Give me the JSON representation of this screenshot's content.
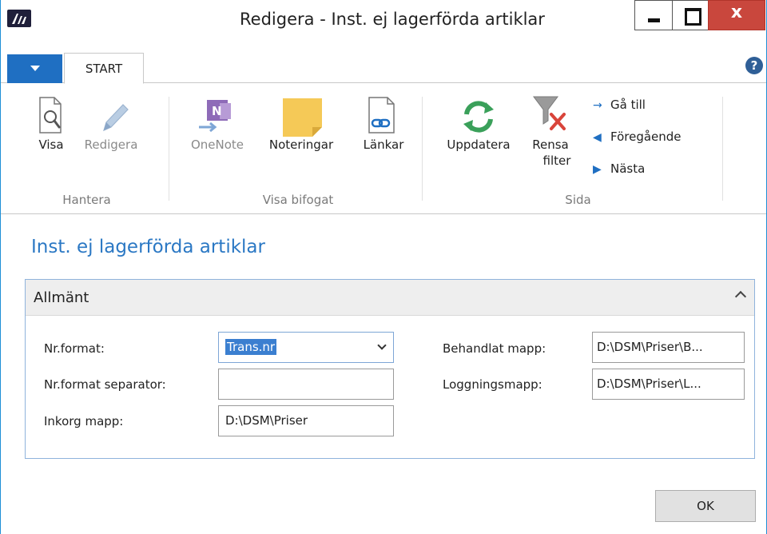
{
  "window": {
    "title": "Redigera - Inst. ej lagerförda artiklar",
    "close_label": "x"
  },
  "tabs": {
    "start": "START",
    "help": "?"
  },
  "ribbon": {
    "groups": {
      "hantera": "Hantera",
      "visa_bifogat": "Visa bifogat",
      "sida": "Sida"
    },
    "buttons": {
      "visa": "Visa",
      "redigera": "Redigera",
      "onenote": "OneNote",
      "noteringar": "Noteringar",
      "lankar": "Länkar",
      "uppdatera": "Uppdatera",
      "rensa_filter_line1": "Rensa",
      "rensa_filter_line2": "filter",
      "ga_till": "Gå till",
      "foregaende": "Föregående",
      "nasta": "Nästa"
    },
    "icons": {
      "onenote_letter": "N",
      "accent": "#1f6fc2",
      "refresh": "#3aa05a",
      "onenote": "#7b3fa0",
      "notes": "#f5c957",
      "close_red": "#d9443a"
    }
  },
  "page": {
    "title": "Inst. ej lagerförda artiklar"
  },
  "fasttab": {
    "title": "Allmänt",
    "fields": {
      "nr_format_label": "Nr.format:",
      "nr_format_value": "Trans.nr",
      "nr_format_separator_label": "Nr.format separator:",
      "nr_format_separator_value": "",
      "inkorg_mapp_label": "Inkorg mapp:",
      "inkorg_mapp_value": "D:\\DSM\\Priser",
      "behandlat_mapp_label": "Behandlat mapp:",
      "behandlat_mapp_value": "D:\\DSM\\Priser\\B...",
      "loggningsmapp_label": "Loggningsmapp:",
      "loggningsmapp_value": "D:\\DSM\\Priser\\L..."
    }
  },
  "footer": {
    "ok": "OK"
  }
}
